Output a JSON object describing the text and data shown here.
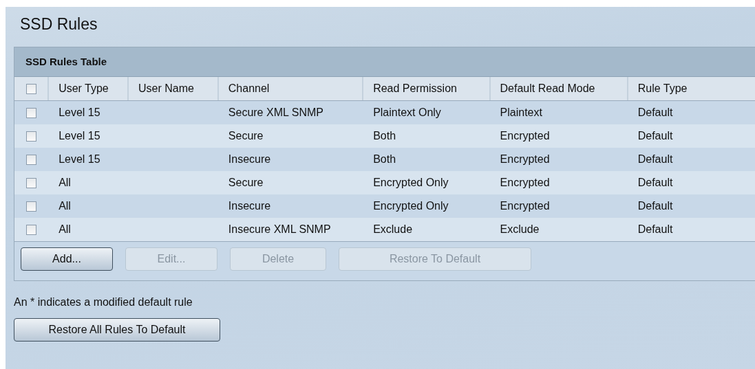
{
  "page": {
    "title": "SSD Rules"
  },
  "table": {
    "title": "SSD Rules Table",
    "select_all": {
      "checked": false
    },
    "columns": [
      "User Type",
      "User Name",
      "Channel",
      "Read Permission",
      "Default Read Mode",
      "Rule Type"
    ],
    "rows": [
      {
        "checked": false,
        "cells": [
          "Level 15",
          "",
          "Secure XML SNMP",
          "Plaintext Only",
          "Plaintext",
          "Default"
        ]
      },
      {
        "checked": false,
        "cells": [
          "Level 15",
          "",
          "Secure",
          "Both",
          "Encrypted",
          "Default"
        ]
      },
      {
        "checked": false,
        "cells": [
          "Level 15",
          "",
          "Insecure",
          "Both",
          "Encrypted",
          "Default"
        ]
      },
      {
        "checked": false,
        "cells": [
          "All",
          "",
          "Secure",
          "Encrypted Only",
          "Encrypted",
          "Default"
        ]
      },
      {
        "checked": false,
        "cells": [
          "All",
          "",
          "Insecure",
          "Encrypted Only",
          "Encrypted",
          "Default"
        ]
      },
      {
        "checked": false,
        "cells": [
          "All",
          "",
          "Insecure XML SNMP",
          "Exclude",
          "Exclude",
          "Default"
        ]
      }
    ],
    "buttons": [
      {
        "label": "Add...",
        "disabled": false
      },
      {
        "label": "Edit...",
        "disabled": true
      },
      {
        "label": "Delete",
        "disabled": true
      },
      {
        "label": "Restore To Default",
        "disabled": true
      }
    ]
  },
  "note": "An * indicates a modified default rule",
  "restore_all_button": {
    "label": "Restore All Rules To Default",
    "disabled": false
  }
}
